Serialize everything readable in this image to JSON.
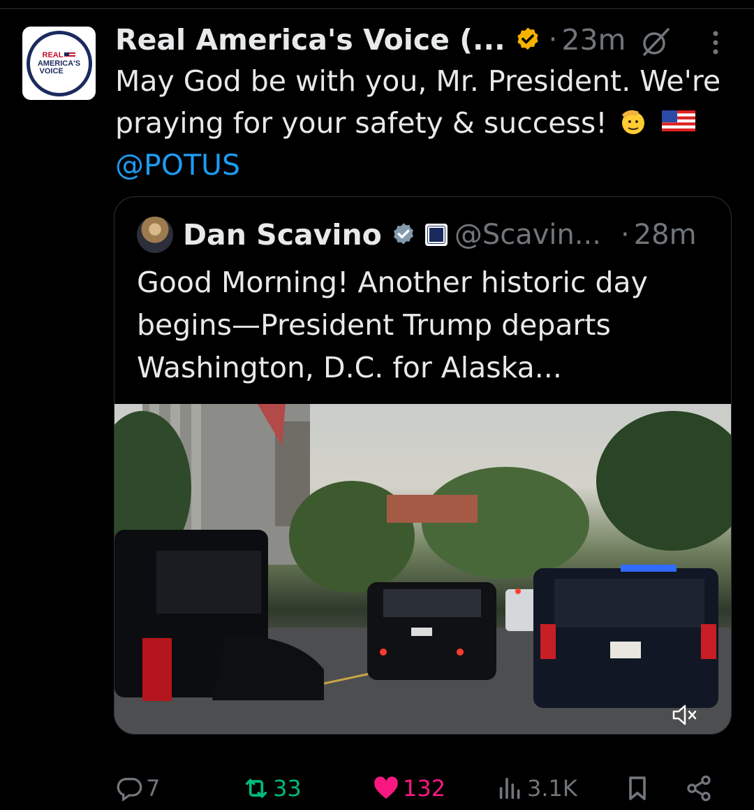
{
  "post": {
    "author_name": "Real America's Voice (...",
    "time": "23m",
    "avatar_logo": {
      "line1": "REAL",
      "line2": "AMERICA'S",
      "line3": "VOICE"
    },
    "text_main": "May God be with you, Mr. President. We're praying for your safety & success!",
    "emojis": [
      "saluting-face",
      "us-flag"
    ],
    "mention": "@POTUS",
    "verified_color": "#f5b300"
  },
  "quote": {
    "author_name": "Dan Scavino",
    "affiliation_badge": "The White House",
    "handle": "@Scavin...",
    "time": "28m",
    "text": "Good Morning! Another historic day begins—President Trump departs Washington, D.C. for Alaska...",
    "video_muted": true
  },
  "actions": {
    "replies": "7",
    "retweets": "33",
    "likes": "132",
    "views": "3.1K"
  },
  "colors": {
    "background": "#000000",
    "text": "#e7e9ea",
    "muted": "#71767b",
    "link": "#1d9bf0",
    "retweet_active": "#00ba7c",
    "like_active": "#f91880",
    "border": "#2f3336"
  },
  "icons": [
    "grok-icon",
    "more-icon",
    "verified-badge-icon",
    "mute-icon",
    "reply-icon",
    "retweet-icon",
    "heart-icon",
    "views-icon",
    "bookmark-icon",
    "share-icon"
  ]
}
